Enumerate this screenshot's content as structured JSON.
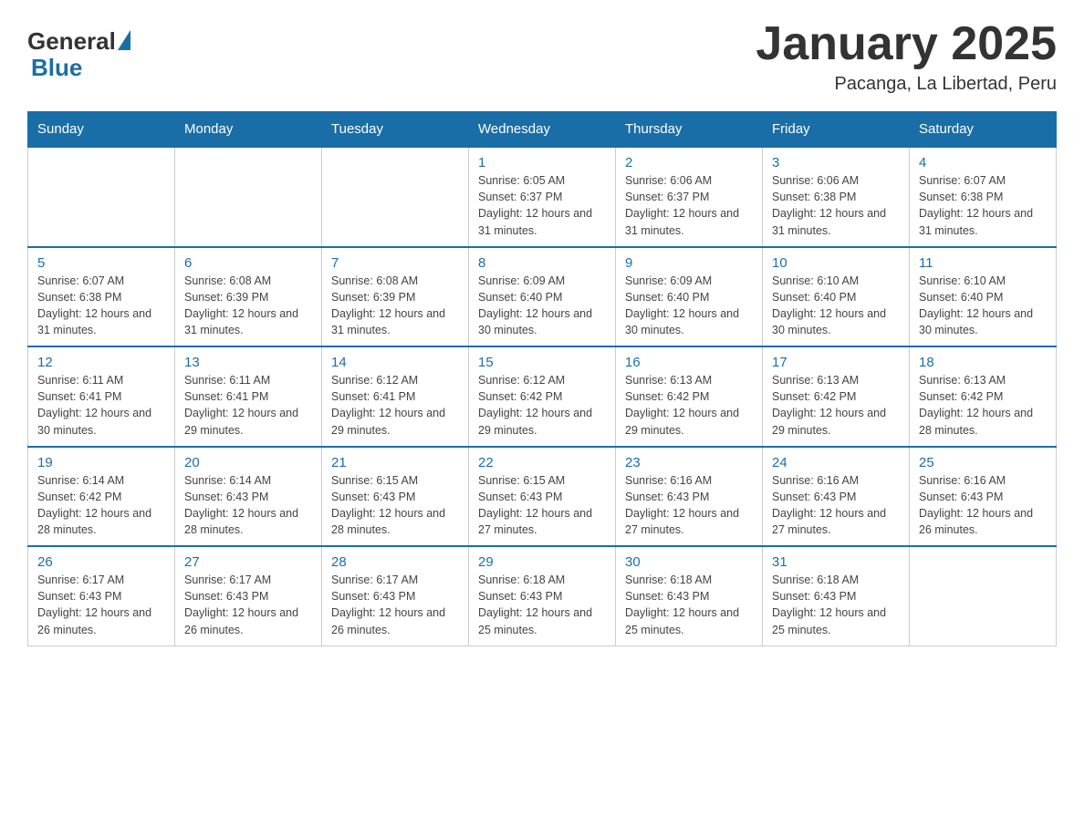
{
  "header": {
    "logo_general": "General",
    "logo_blue": "Blue",
    "title": "January 2025",
    "subtitle": "Pacanga, La Libertad, Peru"
  },
  "days_of_week": [
    "Sunday",
    "Monday",
    "Tuesday",
    "Wednesday",
    "Thursday",
    "Friday",
    "Saturday"
  ],
  "weeks": [
    [
      {
        "day": "",
        "info": ""
      },
      {
        "day": "",
        "info": ""
      },
      {
        "day": "",
        "info": ""
      },
      {
        "day": "1",
        "info": "Sunrise: 6:05 AM\nSunset: 6:37 PM\nDaylight: 12 hours and 31 minutes."
      },
      {
        "day": "2",
        "info": "Sunrise: 6:06 AM\nSunset: 6:37 PM\nDaylight: 12 hours and 31 minutes."
      },
      {
        "day": "3",
        "info": "Sunrise: 6:06 AM\nSunset: 6:38 PM\nDaylight: 12 hours and 31 minutes."
      },
      {
        "day": "4",
        "info": "Sunrise: 6:07 AM\nSunset: 6:38 PM\nDaylight: 12 hours and 31 minutes."
      }
    ],
    [
      {
        "day": "5",
        "info": "Sunrise: 6:07 AM\nSunset: 6:38 PM\nDaylight: 12 hours and 31 minutes."
      },
      {
        "day": "6",
        "info": "Sunrise: 6:08 AM\nSunset: 6:39 PM\nDaylight: 12 hours and 31 minutes."
      },
      {
        "day": "7",
        "info": "Sunrise: 6:08 AM\nSunset: 6:39 PM\nDaylight: 12 hours and 31 minutes."
      },
      {
        "day": "8",
        "info": "Sunrise: 6:09 AM\nSunset: 6:40 PM\nDaylight: 12 hours and 30 minutes."
      },
      {
        "day": "9",
        "info": "Sunrise: 6:09 AM\nSunset: 6:40 PM\nDaylight: 12 hours and 30 minutes."
      },
      {
        "day": "10",
        "info": "Sunrise: 6:10 AM\nSunset: 6:40 PM\nDaylight: 12 hours and 30 minutes."
      },
      {
        "day": "11",
        "info": "Sunrise: 6:10 AM\nSunset: 6:40 PM\nDaylight: 12 hours and 30 minutes."
      }
    ],
    [
      {
        "day": "12",
        "info": "Sunrise: 6:11 AM\nSunset: 6:41 PM\nDaylight: 12 hours and 30 minutes."
      },
      {
        "day": "13",
        "info": "Sunrise: 6:11 AM\nSunset: 6:41 PM\nDaylight: 12 hours and 29 minutes."
      },
      {
        "day": "14",
        "info": "Sunrise: 6:12 AM\nSunset: 6:41 PM\nDaylight: 12 hours and 29 minutes."
      },
      {
        "day": "15",
        "info": "Sunrise: 6:12 AM\nSunset: 6:42 PM\nDaylight: 12 hours and 29 minutes."
      },
      {
        "day": "16",
        "info": "Sunrise: 6:13 AM\nSunset: 6:42 PM\nDaylight: 12 hours and 29 minutes."
      },
      {
        "day": "17",
        "info": "Sunrise: 6:13 AM\nSunset: 6:42 PM\nDaylight: 12 hours and 29 minutes."
      },
      {
        "day": "18",
        "info": "Sunrise: 6:13 AM\nSunset: 6:42 PM\nDaylight: 12 hours and 28 minutes."
      }
    ],
    [
      {
        "day": "19",
        "info": "Sunrise: 6:14 AM\nSunset: 6:42 PM\nDaylight: 12 hours and 28 minutes."
      },
      {
        "day": "20",
        "info": "Sunrise: 6:14 AM\nSunset: 6:43 PM\nDaylight: 12 hours and 28 minutes."
      },
      {
        "day": "21",
        "info": "Sunrise: 6:15 AM\nSunset: 6:43 PM\nDaylight: 12 hours and 28 minutes."
      },
      {
        "day": "22",
        "info": "Sunrise: 6:15 AM\nSunset: 6:43 PM\nDaylight: 12 hours and 27 minutes."
      },
      {
        "day": "23",
        "info": "Sunrise: 6:16 AM\nSunset: 6:43 PM\nDaylight: 12 hours and 27 minutes."
      },
      {
        "day": "24",
        "info": "Sunrise: 6:16 AM\nSunset: 6:43 PM\nDaylight: 12 hours and 27 minutes."
      },
      {
        "day": "25",
        "info": "Sunrise: 6:16 AM\nSunset: 6:43 PM\nDaylight: 12 hours and 26 minutes."
      }
    ],
    [
      {
        "day": "26",
        "info": "Sunrise: 6:17 AM\nSunset: 6:43 PM\nDaylight: 12 hours and 26 minutes."
      },
      {
        "day": "27",
        "info": "Sunrise: 6:17 AM\nSunset: 6:43 PM\nDaylight: 12 hours and 26 minutes."
      },
      {
        "day": "28",
        "info": "Sunrise: 6:17 AM\nSunset: 6:43 PM\nDaylight: 12 hours and 26 minutes."
      },
      {
        "day": "29",
        "info": "Sunrise: 6:18 AM\nSunset: 6:43 PM\nDaylight: 12 hours and 25 minutes."
      },
      {
        "day": "30",
        "info": "Sunrise: 6:18 AM\nSunset: 6:43 PM\nDaylight: 12 hours and 25 minutes."
      },
      {
        "day": "31",
        "info": "Sunrise: 6:18 AM\nSunset: 6:43 PM\nDaylight: 12 hours and 25 minutes."
      },
      {
        "day": "",
        "info": ""
      }
    ]
  ]
}
